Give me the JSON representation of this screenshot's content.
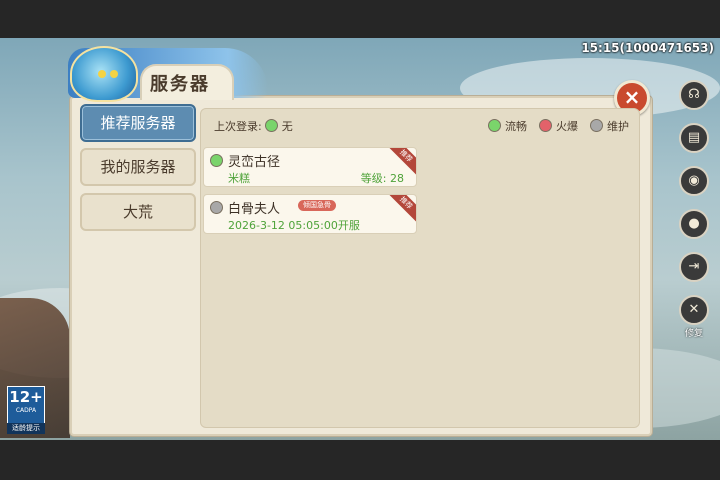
{
  "status_bar": {
    "time_id": "15:15(1000471653)"
  },
  "dialog": {
    "title": "服务器",
    "close_icon": "close-x-icon",
    "tabs": [
      {
        "label": "推荐服务器",
        "active": true
      },
      {
        "label": "我的服务器",
        "active": false
      },
      {
        "label": "大荒",
        "active": false
      }
    ],
    "last_login": {
      "label": "上次登录:",
      "value": "无",
      "status": "green"
    },
    "legend": [
      {
        "label": "流畅",
        "color": "#7ad46b"
      },
      {
        "label": "火爆",
        "color": "#e2626a"
      },
      {
        "label": "维护",
        "color": "#a8a8a8"
      }
    ],
    "servers": [
      {
        "name": "灵峦古径",
        "status": "green",
        "character": "米糕",
        "level_label": "等级:",
        "level": "28",
        "ribbon": "推荐"
      },
      {
        "name": "白骨夫人",
        "status": "gray",
        "tag": "倾国急骨",
        "open_time": "2026-3-12 05:05:00开服",
        "ribbon": "推荐"
      }
    ]
  },
  "side_menu": [
    {
      "icon": "headset-icon",
      "label": ""
    },
    {
      "icon": "notice-icon",
      "label": ""
    },
    {
      "icon": "voice-icon",
      "label": ""
    },
    {
      "icon": "user-center-icon",
      "label": ""
    },
    {
      "icon": "logout-icon",
      "label": ""
    },
    {
      "icon": "repair-tools-icon",
      "label": "修复"
    }
  ],
  "age_rating": {
    "age": "12+",
    "org": "CADPA",
    "tip": "适龄提示"
  }
}
